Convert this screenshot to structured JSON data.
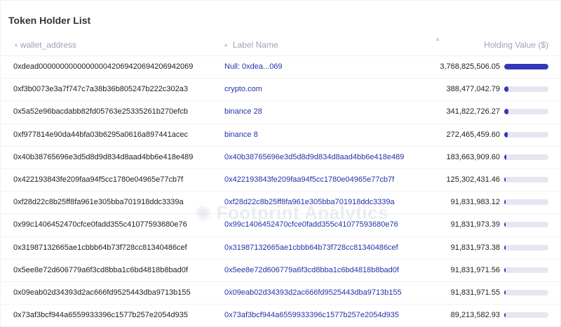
{
  "page": {
    "title": "Token Holder List"
  },
  "table": {
    "columns": {
      "wallet": "wallet_address",
      "label": "Label Name",
      "value": "Holding Value ($)"
    },
    "rows": [
      {
        "wallet": "0xdead000000000000000042069420694206942069",
        "label": "Null: 0xdea...069",
        "value": "3,768,825,506.05",
        "share": 1.0
      },
      {
        "wallet": "0xf3b0073e3a7f747c7a38b36b805247b222c302a3",
        "label": "crypto.com",
        "value": "388,477,042.79",
        "share": 0.103
      },
      {
        "wallet": "0x5a52e96bacdabb82fd05763e25335261b270efcb",
        "label": "binance 28",
        "value": "341,822,726.27",
        "share": 0.091
      },
      {
        "wallet": "0xf977814e90da44bfa03b6295a0616a897441acec",
        "label": "binance 8",
        "value": "272,465,459.60",
        "share": 0.072
      },
      {
        "wallet": "0x40b38765696e3d5d8d9d834d8aad4bb6e418e489",
        "label": "0x40b38765696e3d5d8d9d834d8aad4bb6e418e489",
        "value": "183,663,909.60",
        "share": 0.049
      },
      {
        "wallet": "0x422193843fe209faa94f5cc1780e04965e77cb7f",
        "label": "0x422193843fe209faa94f5cc1780e04965e77cb7f",
        "value": "125,302,431.46",
        "share": 0.033
      },
      {
        "wallet": "0xf28d22c8b25ff8fa961e305bba701918ddc3339a",
        "label": "0xf28d22c8b25ff8fa961e305bba701918ddc3339a",
        "value": "91,831,983.12",
        "share": 0.024
      },
      {
        "wallet": "0x99c1406452470cfce0fadd355c41077593680e76",
        "label": "0x99c1406452470cfce0fadd355c41077593680e76",
        "value": "91,831,973.39",
        "share": 0.024
      },
      {
        "wallet": "0x31987132665ae1cbbb64b73f728cc81340486cef",
        "label": "0x31987132665ae1cbbb64b73f728cc81340486cef",
        "value": "91,831,973.38",
        "share": 0.024
      },
      {
        "wallet": "0x5ee8e72d606779a6f3cd8bba1c6bd4818b8bad0f",
        "label": "0x5ee8e72d606779a6f3cd8bba1c6bd4818b8bad0f",
        "value": "91,831,971.56",
        "share": 0.024
      },
      {
        "wallet": "0x09eab02d34393d2ac666fd9525443dba9713b155",
        "label": "0x09eab02d34393d2ac666fd9525443dba9713b155",
        "value": "91,831,971.55",
        "share": 0.024
      },
      {
        "wallet": "0x73af3bcf944a6559933396c1577b257e2054d935",
        "label": "0x73af3bcf944a6559933396c1577b257e2054d935",
        "value": "89,213,582.93",
        "share": 0.024
      }
    ]
  },
  "watermark": {
    "text": "Footprint Analytics",
    "icon": "footprint-logo-icon"
  },
  "colors": {
    "bar_fill": "#3338b8",
    "bar_track": "#e4e6f2",
    "label_link": "#2233aa"
  }
}
